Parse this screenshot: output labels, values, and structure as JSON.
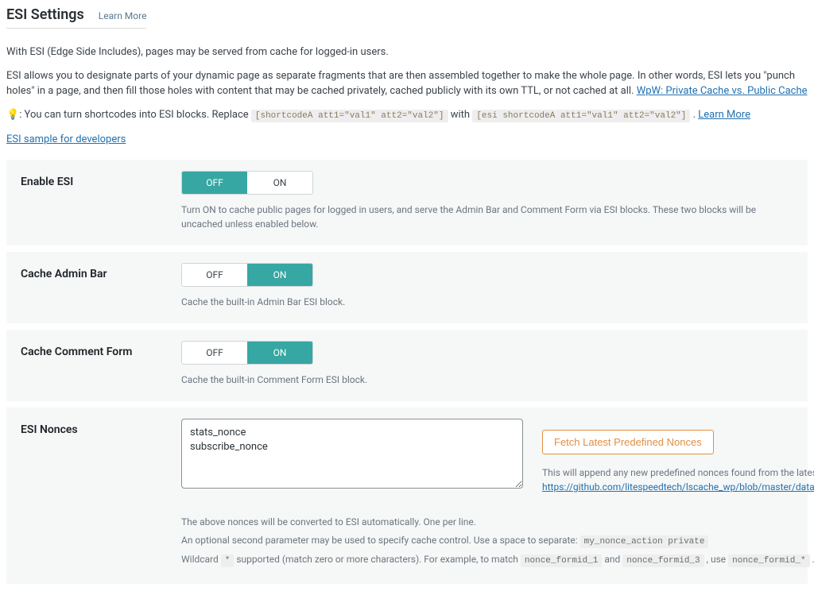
{
  "header": {
    "title": "ESI Settings",
    "learn_more": "Learn More"
  },
  "intro": {
    "p1": "With ESI (Edge Side Includes), pages may be served from cache for logged-in users.",
    "p2a": "ESI allows you to designate parts of your dynamic page as separate fragments that are then assembled together to make the whole page. In other words, ESI lets you \"punch holes\" in a page, and then fill those holes with content that may be cached privately, cached publicly with its own TTL, or not cached at all. ",
    "p2_link": "WpW: Private Cache vs. Public Cache",
    "tip_prefix": ": You can turn shortcodes into ESI blocks. Replace ",
    "tip_code1": "[shortcodeA att1=\"val1\" att2=\"val2\"]",
    "tip_mid": " with ",
    "tip_code2": "[esi shortcodeA att1=\"val1\" att2=\"val2\"]",
    "tip_dot": " . ",
    "tip_learn": "Learn More",
    "dev_sample": "ESI sample for developers"
  },
  "toggles": {
    "off": "OFF",
    "on": "ON"
  },
  "settings": {
    "enable_esi": {
      "label": "Enable ESI",
      "desc": "Turn ON to cache public pages for logged in users, and serve the Admin Bar and Comment Form via ESI blocks. These two blocks will be uncached unless enabled below."
    },
    "cache_admin_bar": {
      "label": "Cache Admin Bar",
      "desc": "Cache the built-in Admin Bar ESI block."
    },
    "cache_comment_form": {
      "label": "Cache Comment Form",
      "desc": "Cache the built-in Comment Form ESI block."
    },
    "esi_nonces": {
      "label": "ESI Nonces",
      "value": "stats_nonce\nsubscribe_nonce",
      "fetch_btn": "Fetch Latest Predefined Nonces",
      "side_text": "This will append any new predefined nonces found from the latest list source: ",
      "side_link": "https://github.com/litespeedtech/lscache_wp/blob/master/data/esi.nonce.txt",
      "help1": "The above nonces will be converted to ESI automatically. One per line.",
      "help2a": "An optional second parameter may be used to specify cache control. Use a space to separate: ",
      "help2_code": "my_nonce_action private",
      "help3a": "Wildcard ",
      "help3_code1": "*",
      "help3b": " supported (match zero or more characters). For example, to match ",
      "help3_code2": "nonce_formid_1",
      "help3c": " and ",
      "help3_code3": "nonce_formid_3",
      "help3d": " , use ",
      "help3_code4": "nonce_formid_*",
      "help3e": " ."
    }
  }
}
